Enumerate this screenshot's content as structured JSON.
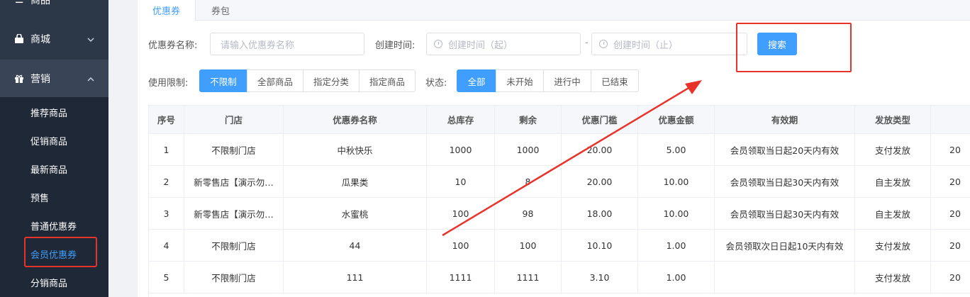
{
  "sidebar": {
    "groups": [
      {
        "label": "商品",
        "icon": "list-icon",
        "chevron": ""
      },
      {
        "label": "商城",
        "icon": "bag-icon",
        "chevron": "﹀"
      },
      {
        "label": "营销",
        "icon": "gift-icon",
        "chevron": "︿"
      }
    ],
    "items": [
      {
        "label": "推荐商品"
      },
      {
        "label": "促销商品"
      },
      {
        "label": "最新商品"
      },
      {
        "label": "预售"
      },
      {
        "label": "普通优惠券"
      },
      {
        "label": "会员优惠券"
      },
      {
        "label": "分销商品"
      }
    ]
  },
  "tabs": [
    {
      "label": "优惠券"
    },
    {
      "label": "券包"
    }
  ],
  "filters": {
    "name_label": "优惠券名称:",
    "name_placeholder": "请输入优惠券名称",
    "time_label": "创建时间:",
    "time_start_placeholder": "创建时间（起）",
    "time_sep": "-",
    "time_end_placeholder": "创建时间（止）",
    "search_button": "搜索",
    "limit_label": "使用限制:",
    "limit_options": [
      "不限制",
      "全部商品",
      "指定分类",
      "指定商品"
    ],
    "limit_selected": "不限制",
    "status_label": "状态:",
    "status_options": [
      "全部",
      "未开始",
      "进行中",
      "已结束"
    ],
    "status_selected": "全部"
  },
  "table": {
    "headers": [
      "序号",
      "门店",
      "优惠券名称",
      "总库存",
      "剩余",
      "优惠门槛",
      "优惠金额",
      "有效期",
      "发放类型",
      ""
    ],
    "rows": [
      [
        "1",
        "不限制门店",
        "中秋快乐",
        "1000",
        "1000",
        "20.00",
        "5.00",
        "会员领取当日起20天内有效",
        "支付发放",
        "20"
      ],
      [
        "2",
        "新零售店【演示勿…",
        "瓜果类",
        "10",
        "8",
        "20.00",
        "10.00",
        "会员领取当日起30天内有效",
        "自主发放",
        "20"
      ],
      [
        "3",
        "新零售店【演示勿…",
        "水蜜桃",
        "100",
        "98",
        "18.00",
        "10.00",
        "会员领取当日起30天内有效",
        "自主发放",
        "20"
      ],
      [
        "4",
        "不限制门店",
        "44",
        "100",
        "100",
        "10.10",
        "1.00",
        "会员领取次日日起10天内有效",
        "支付发放",
        "20"
      ],
      [
        "5",
        "不限制门店",
        "111",
        "1111",
        "1111",
        "3.10",
        "1.00",
        "",
        "支付发放",
        "20"
      ]
    ]
  },
  "colors": {
    "sidebar_bg": "#2c3747",
    "accent": "#409eff",
    "annotation_red": "#e8332b"
  }
}
